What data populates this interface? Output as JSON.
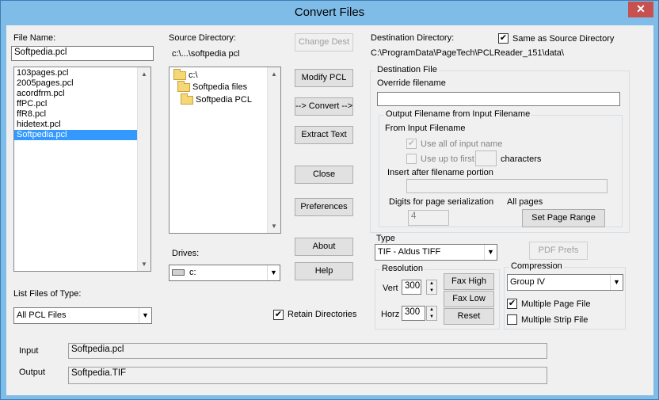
{
  "window": {
    "title": "Convert Files",
    "close_glyph": "✕"
  },
  "file_name": {
    "label": "File Name:",
    "value": "Softpedia.pcl"
  },
  "files": [
    "103pages.pcl",
    "2005pages.pcl",
    "acordfrm.pcl",
    "ffPC.pcl",
    "ffR8.pcl",
    "hidetext.pcl",
    "Softpedia.pcl"
  ],
  "selected_file_index": 6,
  "list_type": {
    "label": "List Files of Type:",
    "value": "All PCL Files"
  },
  "source": {
    "label": "Source Directory:",
    "path": "c:\\...\\softpedia pcl",
    "tree": [
      "c:\\",
      "Softpedia files",
      "Softpedia PCL"
    ]
  },
  "drives": {
    "label": "Drives:",
    "value": "c:"
  },
  "buttons": {
    "change_dest": "Change Dest",
    "modify_pcl": "Modify PCL",
    "convert": "--> Convert -->",
    "extract_text": "Extract Text",
    "close": "Close",
    "preferences": "Preferences",
    "about": "About",
    "help": "Help",
    "set_page_range": "Set Page Range",
    "pdf_prefs": "PDF Prefs",
    "fax_high": "Fax High",
    "fax_low": "Fax Low",
    "reset": "Reset"
  },
  "retain_directories": {
    "label": "Retain Directories",
    "checked": true
  },
  "destination": {
    "label": "Destination Directory:",
    "path": "C:\\ProgramData\\PageTech\\PCLReader_151\\data\\",
    "same_as_source": {
      "label": "Same as Source Directory",
      "checked": true
    }
  },
  "dest_file": {
    "group_title": "Destination File",
    "override_label": "Override filename",
    "override_value": "",
    "output_group_title": "Output Filename from Input Filename",
    "from_input_label": "From Input Filename",
    "use_all": {
      "label": "Use all of input name",
      "checked": true
    },
    "use_up_to": {
      "label": "Use up to first",
      "suffix": "characters",
      "value": ""
    },
    "insert_after_label": "Insert after filename portion",
    "insert_after_value": "",
    "digits_label": "Digits for page serialization",
    "digits_value": "4",
    "all_pages_label": "All pages"
  },
  "type": {
    "label": "Type",
    "value": "TIF - Aldus TIFF"
  },
  "resolution": {
    "group_title": "Resolution",
    "vert_label": "Vert",
    "vert_value": "300",
    "horz_label": "Horz",
    "horz_value": "300"
  },
  "compression": {
    "group_title": "Compression",
    "value": "Group IV",
    "multi_page": {
      "label": "Multiple Page File",
      "checked": true
    },
    "multi_strip": {
      "label": "Multiple Strip File",
      "checked": false
    }
  },
  "io": {
    "input_label": "Input",
    "input_value": "Softpedia.pcl",
    "output_label": "Output",
    "output_value": "Softpedia.TIF"
  },
  "glyphs": {
    "check": "✔",
    "down": "▼",
    "up": "▲"
  }
}
